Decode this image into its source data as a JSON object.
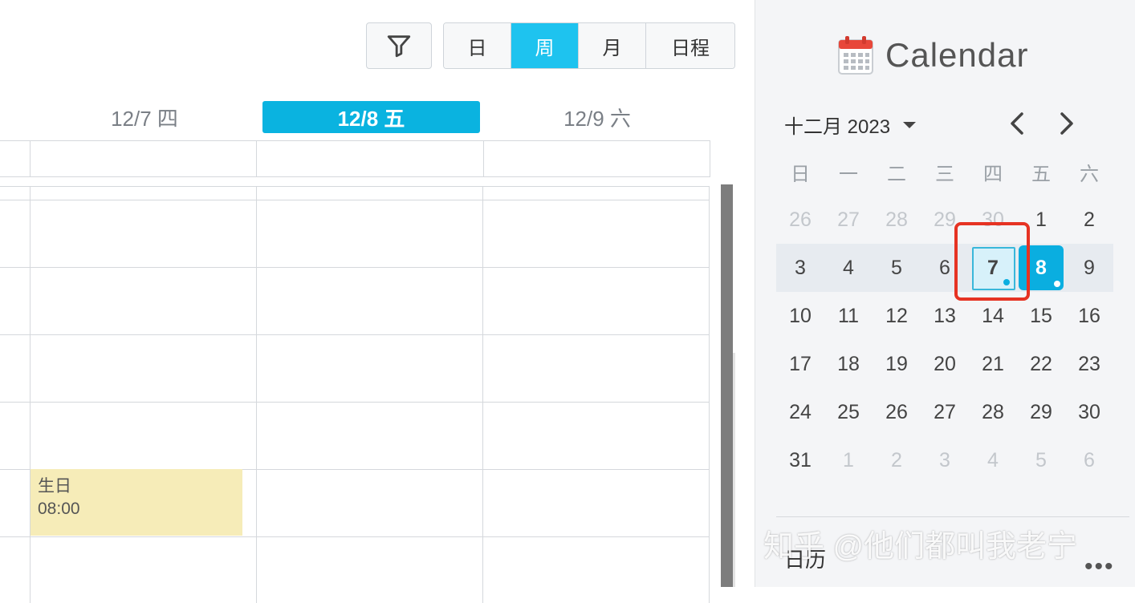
{
  "toolbar": {
    "views": [
      {
        "label": "日",
        "active": false
      },
      {
        "label": "周",
        "active": true
      },
      {
        "label": "月",
        "active": false
      },
      {
        "label": "日程",
        "active": false
      }
    ]
  },
  "day_headers": [
    {
      "label": "12/7 四",
      "today": false
    },
    {
      "label": "12/8 五",
      "today": true
    },
    {
      "label": "12/9 六",
      "today": false
    }
  ],
  "events": [
    {
      "title": "生日",
      "time": "08:00"
    }
  ],
  "sidebar": {
    "title": "Calendar",
    "month_label": "十二月 2023",
    "weekdays": [
      "日",
      "一",
      "二",
      "三",
      "四",
      "五",
      "六"
    ],
    "weeks": [
      [
        "26",
        "27",
        "28",
        "29",
        "30",
        "1",
        "2"
      ],
      [
        "3",
        "4",
        "5",
        "6",
        "7",
        "8",
        "9"
      ],
      [
        "10",
        "11",
        "12",
        "13",
        "14",
        "15",
        "16"
      ],
      [
        "17",
        "18",
        "19",
        "20",
        "21",
        "22",
        "23"
      ],
      [
        "24",
        "25",
        "26",
        "27",
        "28",
        "29",
        "30"
      ],
      [
        "31",
        "1",
        "2",
        "3",
        "4",
        "5",
        "6"
      ]
    ],
    "section_label": "日历",
    "more_label": "•••",
    "watermark": "知乎 @他们都叫我老宁"
  },
  "colors": {
    "accent": "#1ec3ef",
    "today": "#0aaee0",
    "event_bg": "#f6ecb8",
    "highlight": "#e63323"
  }
}
